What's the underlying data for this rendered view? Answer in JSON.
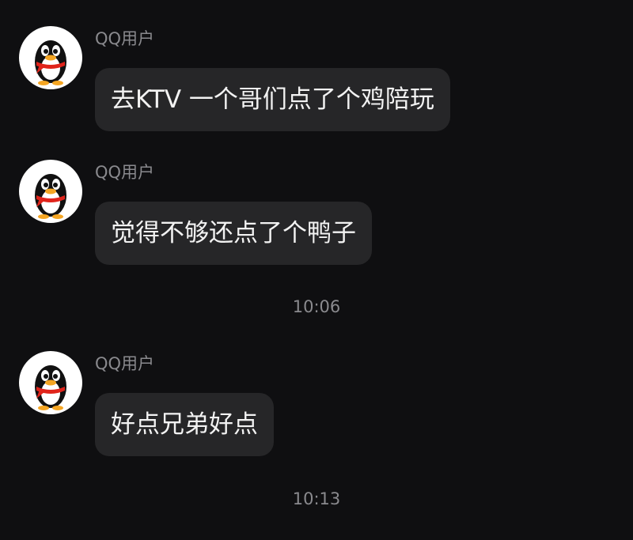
{
  "messages": [
    {
      "sender": "QQ用户",
      "avatar_icon": "qq-penguin-icon",
      "text": "去KTV 一个哥们点了个鸡陪玩"
    },
    {
      "sender": "QQ用户",
      "avatar_icon": "qq-penguin-icon",
      "text": "觉得不够还点了个鸭子"
    },
    {
      "sender": "QQ用户",
      "avatar_icon": "qq-penguin-icon",
      "text": "好点兄弟好点"
    }
  ],
  "timestamps": [
    "10:06",
    "10:13"
  ],
  "colors": {
    "background": "#0f0f11",
    "bubble": "#262628",
    "bubble_text": "#f2f2f2",
    "meta_text": "#8a8a8e",
    "scarf": "#e0241b",
    "beak": "#f5a623"
  }
}
